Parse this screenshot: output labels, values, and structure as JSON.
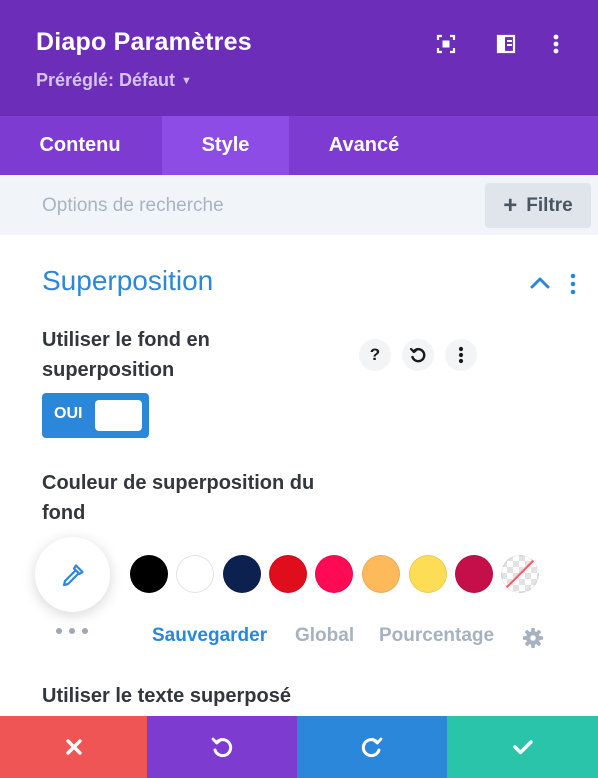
{
  "header": {
    "title": "Diapo Paramètres",
    "preset_label": "Préréglé: Défaut",
    "background": "#6c2eb9",
    "icons": [
      "focus-icon",
      "sidebar-layout-icon",
      "more-vertical-icon"
    ]
  },
  "tabs": [
    {
      "label": "Contenu",
      "active": false
    },
    {
      "label": "Style",
      "active": true
    },
    {
      "label": "Avancé",
      "active": false
    }
  ],
  "search": {
    "placeholder": "Options de recherche",
    "filter_label": "Filtre"
  },
  "section": {
    "title": "Superposition",
    "accent": "#2b87da",
    "overlay_background": {
      "label": "Utiliser le fond en superposition",
      "toggle_label": "OUI",
      "value": true
    },
    "overlay_color": {
      "label": "Couleur de superposition du fond",
      "swatches": [
        "#000000",
        "#ffffff",
        "#0c2150",
        "#e00d1c",
        "#ff0a55",
        "#fdb95a",
        "#fddd56",
        "#c50f4a",
        "transparent"
      ],
      "palette_tabs": [
        {
          "label": "Sauvegarder",
          "active": true
        },
        {
          "label": "Global",
          "active": false
        },
        {
          "label": "Pourcentage",
          "active": false
        }
      ]
    },
    "overlay_text": {
      "label": "Utiliser le texte superposé"
    }
  },
  "footer": {
    "buttons": [
      {
        "name": "cancel",
        "icon": "close-icon",
        "color": "#ef5555"
      },
      {
        "name": "undo",
        "icon": "undo-icon",
        "color": "#7e3bd0"
      },
      {
        "name": "redo",
        "icon": "redo-icon",
        "color": "#2b87da"
      },
      {
        "name": "save",
        "icon": "check-icon",
        "color": "#29c4a9"
      }
    ]
  }
}
